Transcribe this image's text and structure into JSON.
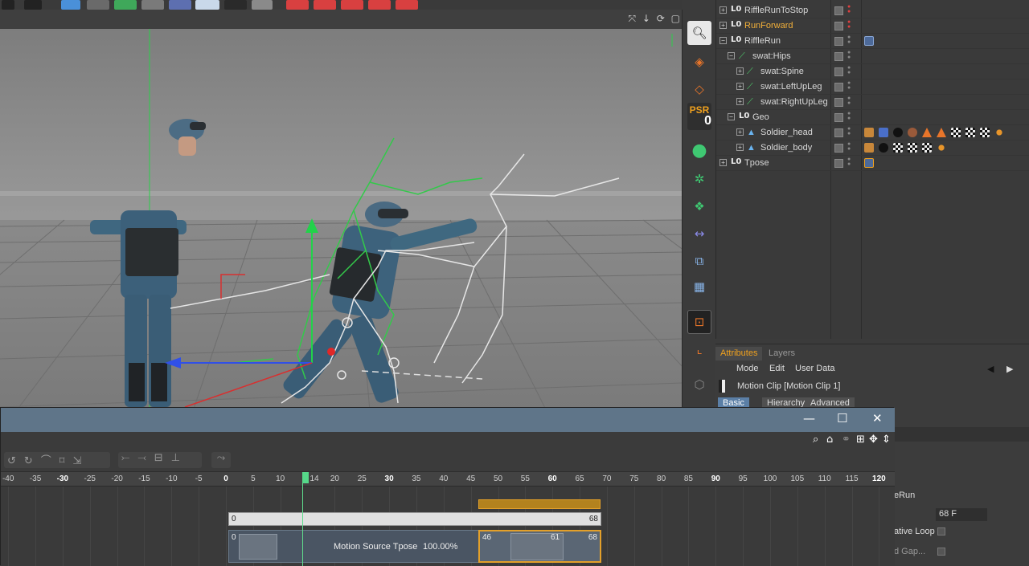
{
  "viewport": {
    "header_icons": "⤧ ↓ ⟳ ▢"
  },
  "palette": {
    "psr_label": "PSR",
    "psr_value": "0"
  },
  "object_manager": {
    "items": [
      {
        "name": "RiffleRunToStop",
        "highlight": false,
        "dot": "red"
      },
      {
        "name": "RunForward",
        "highlight": true,
        "dot": "red"
      },
      {
        "name": "RiffleRun",
        "highlight": false,
        "dot": "grey"
      },
      {
        "name": "swat:Hips",
        "highlight": false,
        "dot": "grey"
      },
      {
        "name": "swat:Spine",
        "highlight": false,
        "dot": "grey"
      },
      {
        "name": "swat:LeftUpLeg",
        "highlight": false,
        "dot": "grey"
      },
      {
        "name": "swat:RightUpLeg",
        "highlight": false,
        "dot": "grey"
      },
      {
        "name": "Geo",
        "highlight": false,
        "dot": "grey"
      },
      {
        "name": "Soldier_head",
        "highlight": false,
        "dot": "grey"
      },
      {
        "name": "Soldier_body",
        "highlight": false,
        "dot": "grey"
      },
      {
        "name": "Tpose",
        "highlight": false,
        "dot": "grey"
      }
    ],
    "null_glyph": "L0"
  },
  "attributes": {
    "tabs": [
      "Attributes",
      "Layers"
    ],
    "menu": [
      "Mode",
      "Edit",
      "User Data"
    ],
    "object_title": "Motion Clip [Motion Clip 1]",
    "subtabs": [
      "Basic",
      "Hierarchy",
      "Advanced"
    ],
    "fields": {
      "source_suffix": "eRun",
      "frames_value": "68 F",
      "relative_loop_label": "ative Loop",
      "fill_gaps_label": "d Gap..."
    }
  },
  "timeline": {
    "window_buttons": {
      "minimize": "—",
      "maximize": "☐",
      "close": "✕"
    },
    "ruler_ticks": [
      "-40",
      "-35",
      "-30",
      "-25",
      "-20",
      "-15",
      "-10",
      "-5",
      "0",
      "5",
      "10",
      "14",
      "20",
      "25",
      "30",
      "35",
      "40",
      "45",
      "50",
      "55",
      "60",
      "65",
      "70",
      "75",
      "80",
      "85",
      "90",
      "95",
      "100",
      "105",
      "110",
      "115",
      "120"
    ],
    "current_frame": "14",
    "clip_bar": {
      "start": "0",
      "end": "68"
    },
    "motion_source": {
      "label": "Motion Source Tpose",
      "weight": "100.00%",
      "start": "0",
      "trans_start": "46",
      "trans_mid": "61",
      "trans_end": "68"
    }
  },
  "colors": {
    "accent_orange": "#e3a02a",
    "selected_tab": "#5b7fa6",
    "titlebar": "#5f7589",
    "playhead": "#56d98a"
  }
}
